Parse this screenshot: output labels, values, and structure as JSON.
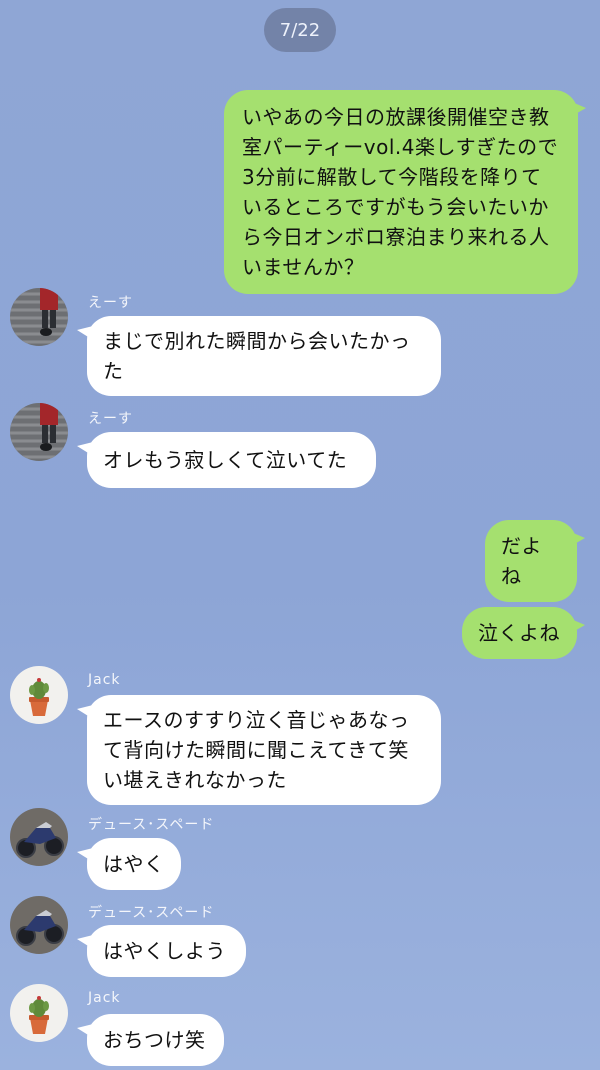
{
  "chat": {
    "date": "7/22",
    "messages": [
      {
        "direction": "out",
        "text": "いやあの今日の放課後開催空き教室パーティーvol.4楽しすぎたので3分前に解散して今階段を降りているところですがもう会いたいから今日オンボロ寮泊まり来れる人いませんか？"
      },
      {
        "direction": "in",
        "sender": "えーす",
        "avatar": "ace-avatar",
        "text": "まじで別れた瞬間から会いたかった"
      },
      {
        "direction": "in",
        "sender": "えーす",
        "avatar": "ace-avatar",
        "text": "オレもう寂しくて泣いてた"
      },
      {
        "direction": "out",
        "text": "だよね"
      },
      {
        "direction": "out",
        "text": "泣くよね"
      },
      {
        "direction": "in",
        "sender": "Jack",
        "avatar": "cactus-avatar",
        "text": "エースのすすり泣く音じゃあなって背向けた瞬間に聞こえてきて笑い堪えきれなかった"
      },
      {
        "direction": "in",
        "sender": "デュース･スペード",
        "avatar": "motorcycle-avatar",
        "text": "はやく"
      },
      {
        "direction": "in",
        "sender": "デュース･スペード",
        "avatar": "motorcycle-avatar",
        "text": "はやくしよう"
      },
      {
        "direction": "in",
        "sender": "Jack",
        "avatar": "cactus-avatar",
        "text": "おちつけ笑"
      }
    ]
  },
  "colors": {
    "background": "#8fa6d5",
    "outgoing_bubble": "#a5e06f",
    "incoming_bubble": "#ffffff"
  }
}
